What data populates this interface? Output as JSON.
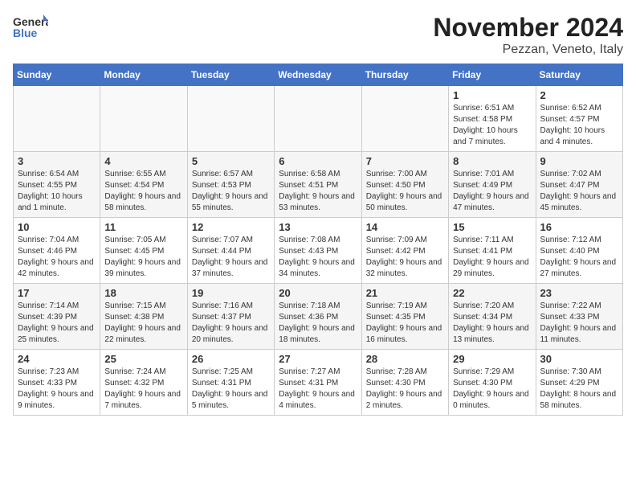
{
  "header": {
    "logo_text_general": "General",
    "logo_text_blue": "Blue",
    "month_title": "November 2024",
    "location": "Pezzan, Veneto, Italy"
  },
  "days_of_week": [
    "Sunday",
    "Monday",
    "Tuesday",
    "Wednesday",
    "Thursday",
    "Friday",
    "Saturday"
  ],
  "weeks": [
    [
      {
        "day": "",
        "info": ""
      },
      {
        "day": "",
        "info": ""
      },
      {
        "day": "",
        "info": ""
      },
      {
        "day": "",
        "info": ""
      },
      {
        "day": "",
        "info": ""
      },
      {
        "day": "1",
        "info": "Sunrise: 6:51 AM\nSunset: 4:58 PM\nDaylight: 10 hours and 7 minutes."
      },
      {
        "day": "2",
        "info": "Sunrise: 6:52 AM\nSunset: 4:57 PM\nDaylight: 10 hours and 4 minutes."
      }
    ],
    [
      {
        "day": "3",
        "info": "Sunrise: 6:54 AM\nSunset: 4:55 PM\nDaylight: 10 hours and 1 minute."
      },
      {
        "day": "4",
        "info": "Sunrise: 6:55 AM\nSunset: 4:54 PM\nDaylight: 9 hours and 58 minutes."
      },
      {
        "day": "5",
        "info": "Sunrise: 6:57 AM\nSunset: 4:53 PM\nDaylight: 9 hours and 55 minutes."
      },
      {
        "day": "6",
        "info": "Sunrise: 6:58 AM\nSunset: 4:51 PM\nDaylight: 9 hours and 53 minutes."
      },
      {
        "day": "7",
        "info": "Sunrise: 7:00 AM\nSunset: 4:50 PM\nDaylight: 9 hours and 50 minutes."
      },
      {
        "day": "8",
        "info": "Sunrise: 7:01 AM\nSunset: 4:49 PM\nDaylight: 9 hours and 47 minutes."
      },
      {
        "day": "9",
        "info": "Sunrise: 7:02 AM\nSunset: 4:47 PM\nDaylight: 9 hours and 45 minutes."
      }
    ],
    [
      {
        "day": "10",
        "info": "Sunrise: 7:04 AM\nSunset: 4:46 PM\nDaylight: 9 hours and 42 minutes."
      },
      {
        "day": "11",
        "info": "Sunrise: 7:05 AM\nSunset: 4:45 PM\nDaylight: 9 hours and 39 minutes."
      },
      {
        "day": "12",
        "info": "Sunrise: 7:07 AM\nSunset: 4:44 PM\nDaylight: 9 hours and 37 minutes."
      },
      {
        "day": "13",
        "info": "Sunrise: 7:08 AM\nSunset: 4:43 PM\nDaylight: 9 hours and 34 minutes."
      },
      {
        "day": "14",
        "info": "Sunrise: 7:09 AM\nSunset: 4:42 PM\nDaylight: 9 hours and 32 minutes."
      },
      {
        "day": "15",
        "info": "Sunrise: 7:11 AM\nSunset: 4:41 PM\nDaylight: 9 hours and 29 minutes."
      },
      {
        "day": "16",
        "info": "Sunrise: 7:12 AM\nSunset: 4:40 PM\nDaylight: 9 hours and 27 minutes."
      }
    ],
    [
      {
        "day": "17",
        "info": "Sunrise: 7:14 AM\nSunset: 4:39 PM\nDaylight: 9 hours and 25 minutes."
      },
      {
        "day": "18",
        "info": "Sunrise: 7:15 AM\nSunset: 4:38 PM\nDaylight: 9 hours and 22 minutes."
      },
      {
        "day": "19",
        "info": "Sunrise: 7:16 AM\nSunset: 4:37 PM\nDaylight: 9 hours and 20 minutes."
      },
      {
        "day": "20",
        "info": "Sunrise: 7:18 AM\nSunset: 4:36 PM\nDaylight: 9 hours and 18 minutes."
      },
      {
        "day": "21",
        "info": "Sunrise: 7:19 AM\nSunset: 4:35 PM\nDaylight: 9 hours and 16 minutes."
      },
      {
        "day": "22",
        "info": "Sunrise: 7:20 AM\nSunset: 4:34 PM\nDaylight: 9 hours and 13 minutes."
      },
      {
        "day": "23",
        "info": "Sunrise: 7:22 AM\nSunset: 4:33 PM\nDaylight: 9 hours and 11 minutes."
      }
    ],
    [
      {
        "day": "24",
        "info": "Sunrise: 7:23 AM\nSunset: 4:33 PM\nDaylight: 9 hours and 9 minutes."
      },
      {
        "day": "25",
        "info": "Sunrise: 7:24 AM\nSunset: 4:32 PM\nDaylight: 9 hours and 7 minutes."
      },
      {
        "day": "26",
        "info": "Sunrise: 7:25 AM\nSunset: 4:31 PM\nDaylight: 9 hours and 5 minutes."
      },
      {
        "day": "27",
        "info": "Sunrise: 7:27 AM\nSunset: 4:31 PM\nDaylight: 9 hours and 4 minutes."
      },
      {
        "day": "28",
        "info": "Sunrise: 7:28 AM\nSunset: 4:30 PM\nDaylight: 9 hours and 2 minutes."
      },
      {
        "day": "29",
        "info": "Sunrise: 7:29 AM\nSunset: 4:30 PM\nDaylight: 9 hours and 0 minutes."
      },
      {
        "day": "30",
        "info": "Sunrise: 7:30 AM\nSunset: 4:29 PM\nDaylight: 8 hours and 58 minutes."
      }
    ]
  ],
  "colors": {
    "header_bg": "#4472C4",
    "header_text": "#ffffff",
    "odd_row_bg": "#ffffff",
    "even_row_bg": "#f5f5f5"
  }
}
